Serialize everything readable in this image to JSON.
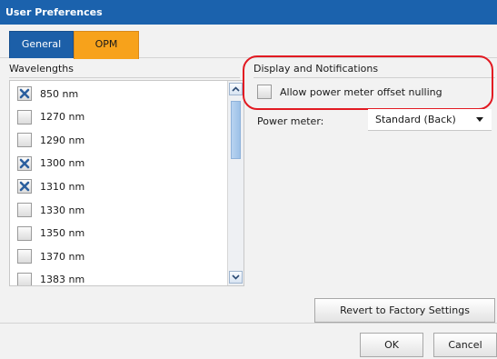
{
  "window": {
    "title": "User Preferences"
  },
  "tabs": [
    {
      "label": "General",
      "active": false
    },
    {
      "label": "OPM",
      "active": true
    }
  ],
  "wavelengths": {
    "section_label": "Wavelengths",
    "items": [
      {
        "label": "850 nm",
        "checked": true
      },
      {
        "label": "1270 nm",
        "checked": false
      },
      {
        "label": "1290 nm",
        "checked": false
      },
      {
        "label": "1300 nm",
        "checked": true
      },
      {
        "label": "1310 nm",
        "checked": true
      },
      {
        "label": "1330 nm",
        "checked": false
      },
      {
        "label": "1350 nm",
        "checked": false
      },
      {
        "label": "1370 nm",
        "checked": false
      },
      {
        "label": "1383 nm",
        "checked": false
      }
    ]
  },
  "display": {
    "section_label": "Display and Notifications",
    "offset_nulling_label": "Allow power meter offset nulling",
    "offset_nulling_checked": false,
    "power_meter_label": "Power meter:",
    "power_meter_value": "Standard (Back)"
  },
  "buttons": {
    "revert": "Revert to Factory Settings",
    "ok": "OK",
    "cancel": "Cancel"
  },
  "colors": {
    "titlebar": "#1b62ad",
    "active_tab": "#f7a21b",
    "inactive_tab": "#1c5fa8",
    "highlight": "#e21a22",
    "checkmark": "#2b5f9e"
  }
}
